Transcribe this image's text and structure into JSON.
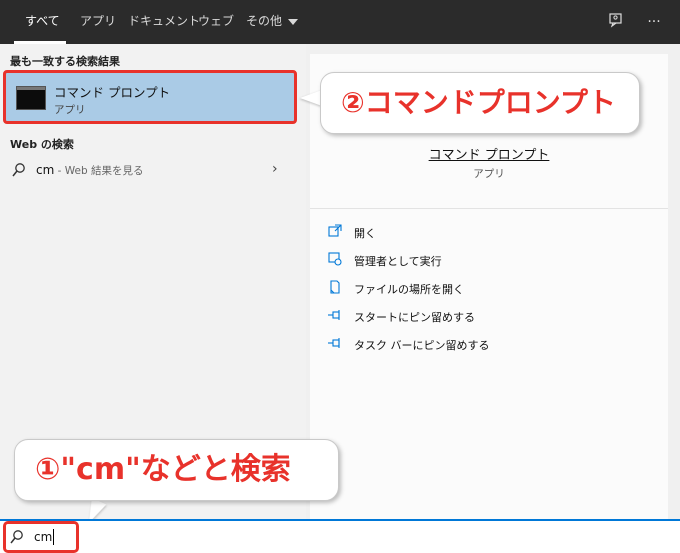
{
  "tabs": [
    {
      "label": "すべて",
      "active": true
    },
    {
      "label": "アプリ",
      "active": false
    },
    {
      "label": "ドキュメント",
      "active": false
    },
    {
      "label": "ウェブ",
      "active": false
    },
    {
      "label": "その他",
      "active": false
    }
  ],
  "left": {
    "best_match_heading": "最も一致する検索結果",
    "best_match": {
      "title": "コマンド プロンプト",
      "subtitle": "アプリ"
    },
    "web_heading": "Web の検索",
    "web_query": "cm",
    "web_suffix": " - Web 結果を見る"
  },
  "right": {
    "title": "コマンド プロンプト",
    "subtitle": "アプリ",
    "actions": [
      {
        "label": "開く",
        "icon": "open-icon"
      },
      {
        "label": "管理者として実行",
        "icon": "run-as-admin-icon"
      },
      {
        "label": "ファイルの場所を開く",
        "icon": "file-location-icon"
      },
      {
        "label": "スタートにピン留めする",
        "icon": "pin-icon"
      },
      {
        "label": "タスク バーにピン留めする",
        "icon": "pin-icon"
      }
    ]
  },
  "callouts": {
    "step1": "①\"cm\"などと検索",
    "step2": "②コマンドプロンプト"
  },
  "search": {
    "value": "cm"
  },
  "colors": {
    "accent": "#0078d7",
    "highlight": "#e8322b",
    "selection": "#aacbe6"
  }
}
